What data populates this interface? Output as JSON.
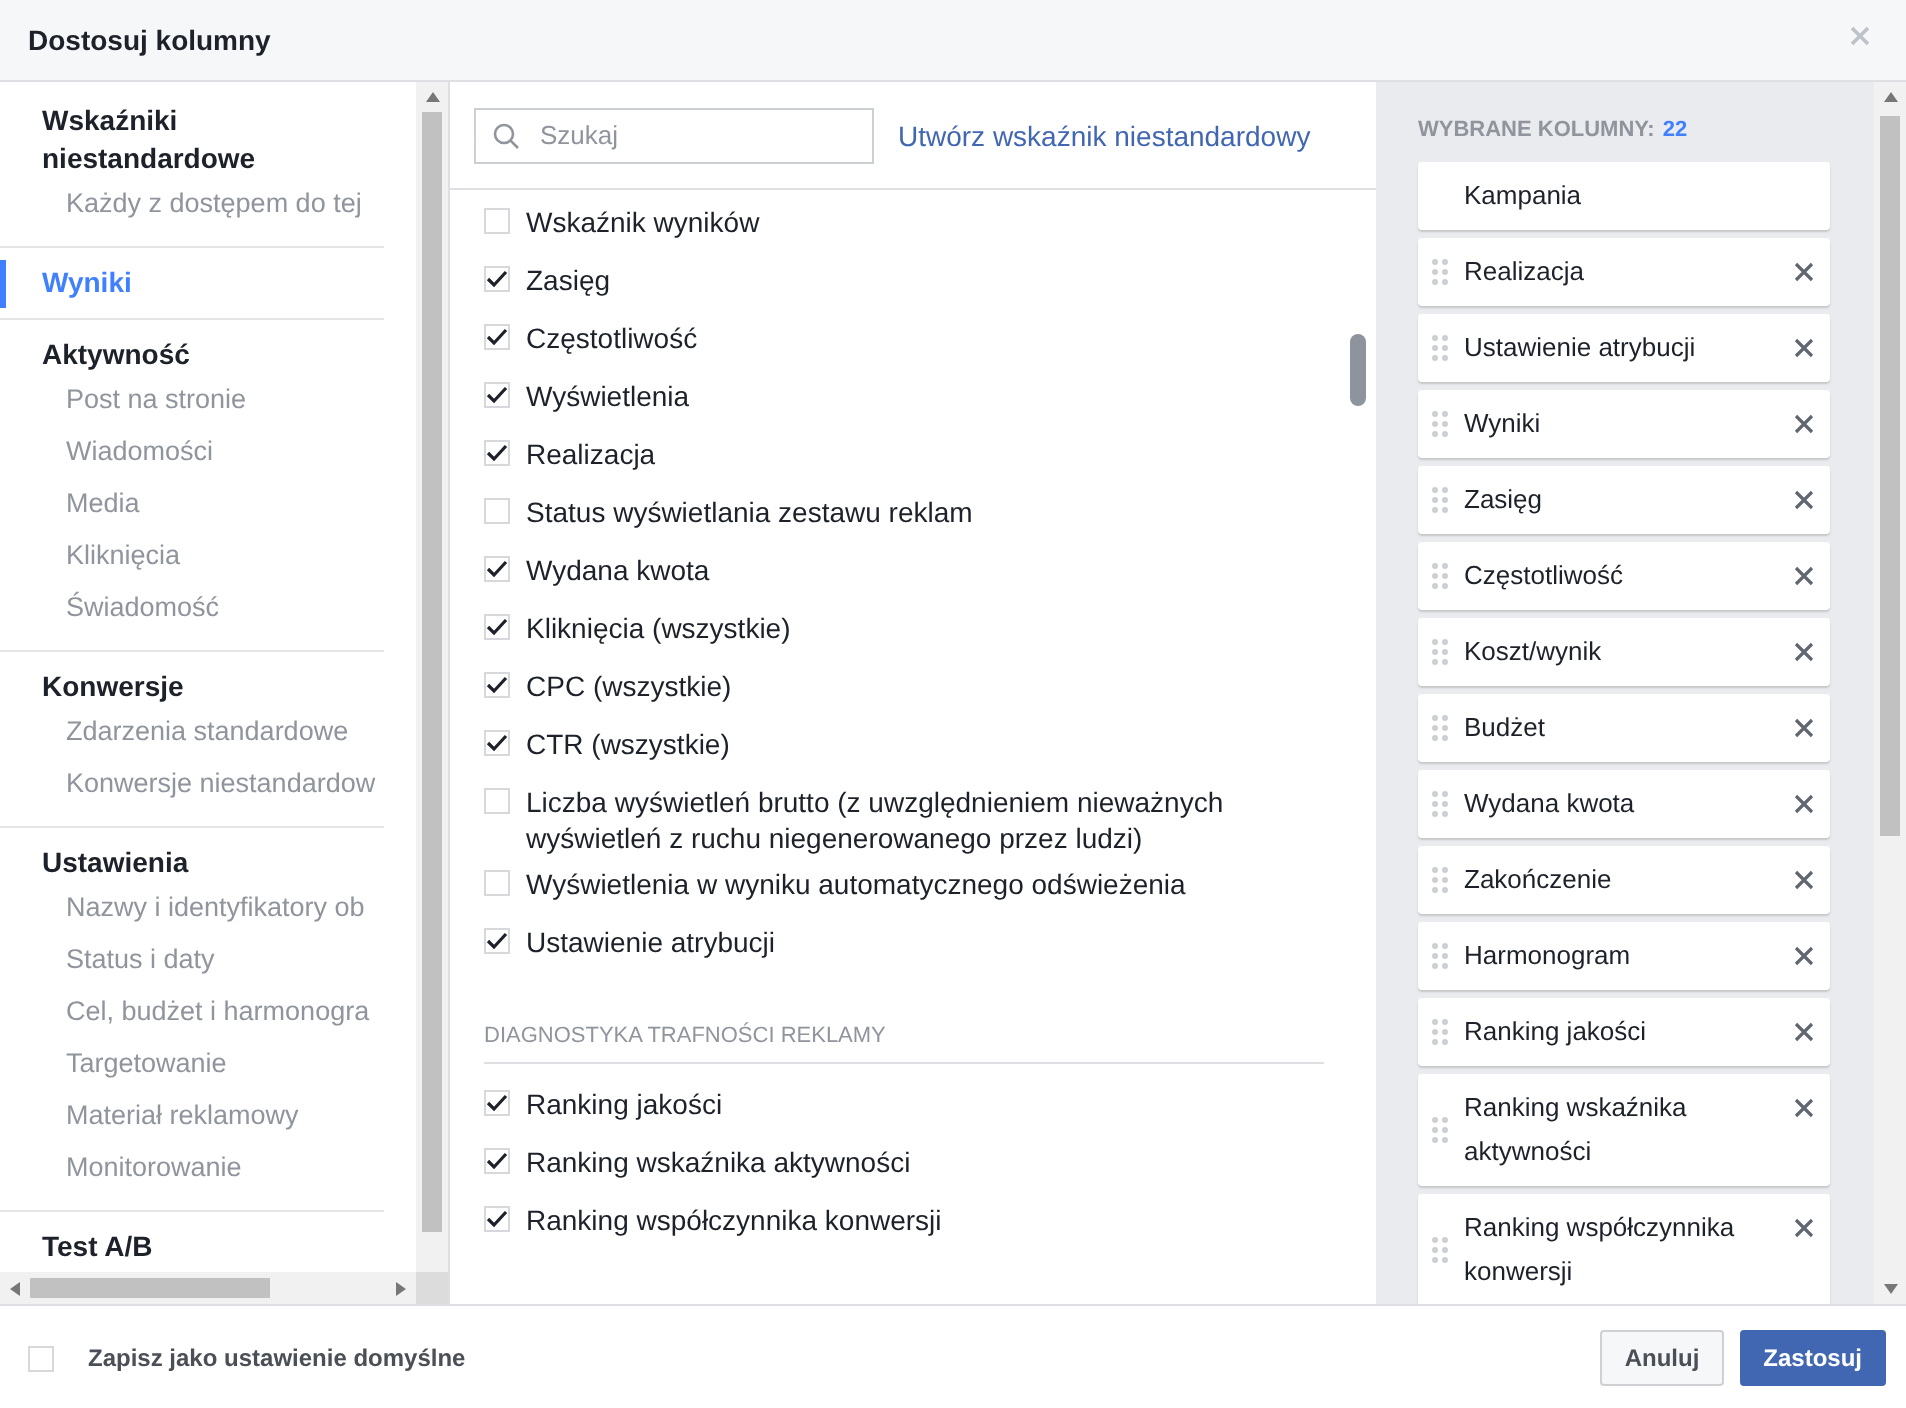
{
  "window": {
    "title": "Dostosuj kolumny"
  },
  "sidebar": {
    "sections": [
      {
        "title": "Wskaźniki niestandardowe",
        "selected": false,
        "items": [
          "Każdy z dostępem do tej"
        ]
      },
      {
        "title": "Wyniki",
        "selected": true
      },
      {
        "title": "Aktywność",
        "selected": false,
        "items": [
          "Post na stronie",
          "Wiadomości",
          "Media",
          "Kliknięcia",
          "Świadomość"
        ]
      },
      {
        "title": "Konwersje",
        "selected": false,
        "items": [
          "Zdarzenia standardowe",
          "Konwersje niestandardow"
        ]
      },
      {
        "title": "Ustawienia",
        "selected": false,
        "items": [
          "Nazwy i identyfikatory ob",
          "Status i daty",
          "Cel, budżet i harmonogra",
          "Targetowanie",
          "Materiał reklamowy",
          "Monitorowanie"
        ]
      },
      {
        "title": "Test A/B",
        "selected": false
      }
    ]
  },
  "search": {
    "placeholder": "Szukaj"
  },
  "create_link": "Utwórz wskaźnik niestandardowy",
  "groups": [
    {
      "items": [
        {
          "label": "Wskaźnik wyników",
          "checked": false
        },
        {
          "label": "Zasięg",
          "checked": true
        },
        {
          "label": "Częstotliwość",
          "checked": true
        },
        {
          "label": "Wyświetlenia",
          "checked": true
        },
        {
          "label": "Realizacja",
          "checked": true
        },
        {
          "label": "Status wyświetlania zestawu reklam",
          "checked": false
        },
        {
          "label": "Wydana kwota",
          "checked": true
        },
        {
          "label": "Kliknięcia (wszystkie)",
          "checked": true
        },
        {
          "label": "CPC (wszystkie)",
          "checked": true
        },
        {
          "label": "CTR (wszystkie)",
          "checked": true
        },
        {
          "label": "Liczba wyświetleń brutto (z uwzględnieniem nieważnych wyświetleń z ruchu niegenerowanego przez ludzi)",
          "checked": false
        },
        {
          "label": "Wyświetlenia w wyniku automatycznego odświeżenia",
          "checked": false
        },
        {
          "label": "Ustawienie atrybucji",
          "checked": true
        }
      ]
    },
    {
      "heading": "DIAGNOSTYKA TRAFNOŚCI REKLAMY",
      "items": [
        {
          "label": "Ranking jakości",
          "checked": true
        },
        {
          "label": "Ranking wskaźnika aktywności",
          "checked": true
        },
        {
          "label": "Ranking współczynnika konwersji",
          "checked": true
        }
      ]
    }
  ],
  "selected_columns": {
    "title": "WYBRANE KOLUMNY:",
    "count": "22",
    "columns": [
      {
        "label": "Kampania",
        "removable": false
      },
      {
        "label": "Realizacja",
        "removable": true
      },
      {
        "label": "Ustawienie atrybucji",
        "removable": true
      },
      {
        "label": "Wyniki",
        "removable": true
      },
      {
        "label": "Zasięg",
        "removable": true
      },
      {
        "label": "Częstotliwość",
        "removable": true
      },
      {
        "label": "Koszt/wynik",
        "removable": true
      },
      {
        "label": "Budżet",
        "removable": true
      },
      {
        "label": "Wydana kwota",
        "removable": true
      },
      {
        "label": "Zakończenie",
        "removable": true
      },
      {
        "label": "Harmonogram",
        "removable": true
      },
      {
        "label": "Ranking jakości",
        "removable": true
      },
      {
        "label": "Ranking wskaźnika aktywności",
        "removable": true
      },
      {
        "label": "Ranking współczynnika konwersji",
        "removable": true
      }
    ]
  },
  "footer": {
    "save_default": {
      "label": "Zapisz jako ustawienie domyślne",
      "checked": false
    },
    "buttons": [
      {
        "label": "Anuluj",
        "kind": "secondary"
      },
      {
        "label": "Zastosuj",
        "kind": "primary"
      }
    ]
  }
}
